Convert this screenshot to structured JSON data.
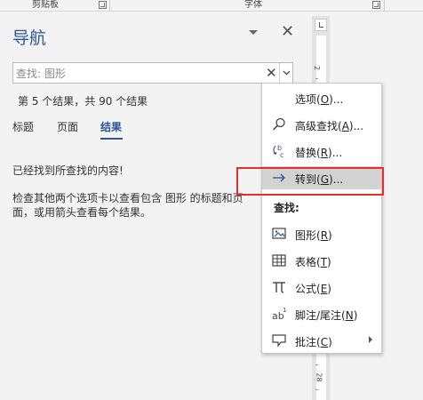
{
  "ribbon": {
    "group_clipboard": "剪贴板",
    "group_font": "字体"
  },
  "nav_pane": {
    "title": "导航",
    "search_value": "查找: 图形",
    "clear_glyph": "✕",
    "result_count": "第 5 个结果，共 90 个结果",
    "tabs": [
      {
        "label": "标题"
      },
      {
        "label": "页面"
      },
      {
        "label": "结果"
      }
    ],
    "active_tab": "结果",
    "message_found": "已经找到所查找的内容!",
    "message_hint": "检查其他两个选项卡以查看包含 图形 的标题和页面，或用箭头查看每个结果。"
  },
  "ruler": {
    "numbers": [
      "2",
      "28"
    ]
  },
  "context_menu": {
    "items": [
      {
        "label": "选项(",
        "key": "O",
        "suffix": ")...",
        "icon": "none"
      },
      {
        "label": "高级查找(",
        "key": "A",
        "suffix": ")...",
        "icon": "search-icon"
      },
      {
        "label": "替换(",
        "key": "R",
        "suffix": ")...",
        "icon": "replace-icon"
      },
      {
        "label": "转到(",
        "key": "G",
        "suffix": ")...",
        "icon": "arrow-right-icon"
      }
    ],
    "find_section_label": "查找:",
    "find_items": [
      {
        "label": "图形(",
        "key": "R",
        "suffix": ")",
        "icon": "graphic-icon"
      },
      {
        "label": "表格(",
        "key": "T",
        "suffix": ")",
        "icon": "table-icon"
      },
      {
        "label": "公式(",
        "key": "E",
        "suffix": ")",
        "icon": "pi-icon"
      },
      {
        "label": "脚注/尾注(",
        "key": "N",
        "suffix": ")",
        "icon": "footnote-icon"
      },
      {
        "label": "批注(",
        "key": "C",
        "suffix": ")",
        "icon": "comment-icon"
      }
    ],
    "highlighted_item": "转到(G)..."
  },
  "colors": {
    "accent": "#2b579a",
    "highlight_box": "#e03030"
  }
}
